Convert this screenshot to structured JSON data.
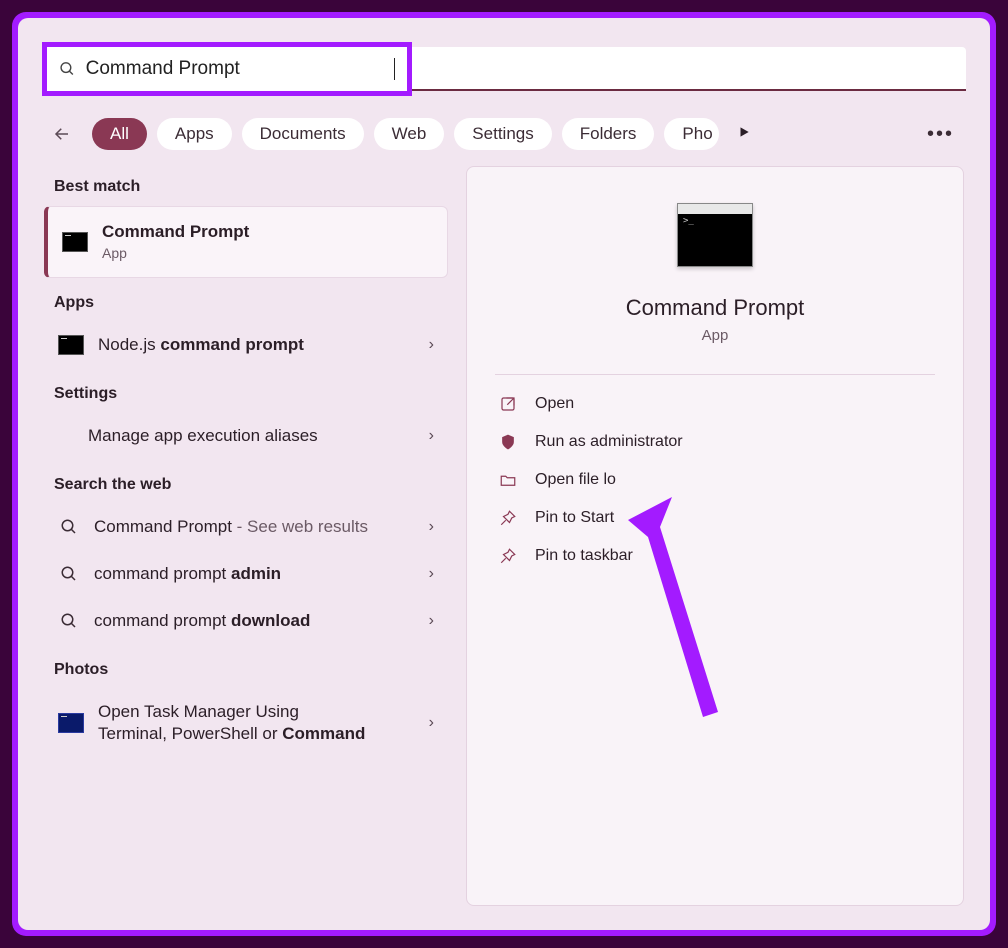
{
  "search": {
    "query": "Command Prompt"
  },
  "filters": {
    "all": "All",
    "apps": "Apps",
    "documents": "Documents",
    "web": "Web",
    "settings": "Settings",
    "folders": "Folders",
    "photos": "Pho"
  },
  "left": {
    "best_match_header": "Best match",
    "best_match": {
      "title": "Command Prompt",
      "sub": "App"
    },
    "apps_header": "Apps",
    "apps": [
      {
        "prefix": "Node.js ",
        "bold": "command prompt"
      }
    ],
    "settings_header": "Settings",
    "settings": [
      {
        "label": "Manage app execution aliases"
      }
    ],
    "web_header": "Search the web",
    "web": [
      {
        "prefix": "Command Prompt",
        "suffix": " - See web results"
      },
      {
        "prefix": "command prompt ",
        "bold": "admin"
      },
      {
        "prefix": "command prompt ",
        "bold": "download"
      }
    ],
    "photos_header": "Photos",
    "photos": [
      {
        "line1": "Open Task Manager Using",
        "line2_a": "Terminal, PowerShell or ",
        "line2_b": "Command"
      }
    ]
  },
  "right": {
    "title": "Command Prompt",
    "sub": "App",
    "actions": {
      "open": "Open",
      "run_admin": "Run as administrator",
      "open_loc": "Open file lo",
      "pin_start": "Pin to Start",
      "pin_taskbar": "Pin to taskbar"
    }
  }
}
